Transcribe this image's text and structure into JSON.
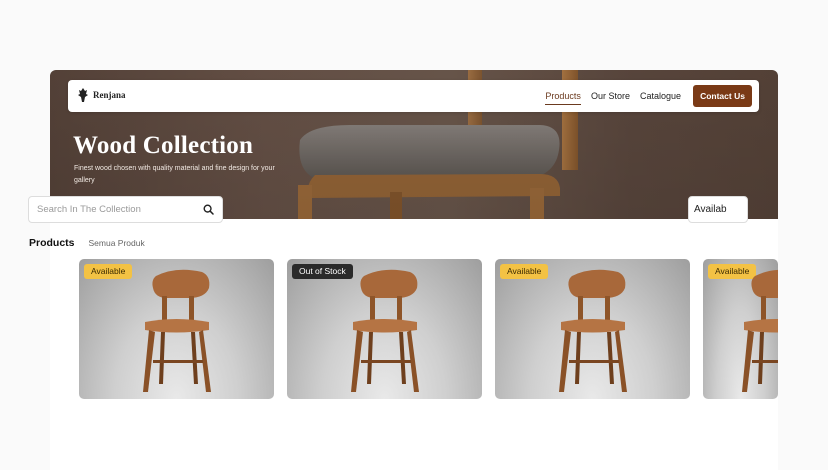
{
  "brand": {
    "name": "Renjana"
  },
  "nav": {
    "items": [
      {
        "label": "Products",
        "active": true
      },
      {
        "label": "Our Store",
        "active": false
      },
      {
        "label": "Catalogue",
        "active": false
      }
    ],
    "contact_label": "Contact Us"
  },
  "hero": {
    "title": "Wood Collection",
    "subtitle": "Finest wood chosen with quality material and fine design for your gallery"
  },
  "search": {
    "placeholder": "Search In The Collection"
  },
  "filter": {
    "selected": "Availab"
  },
  "tabs": {
    "primary": "Products",
    "secondary": "Semua Produk"
  },
  "products": [
    {
      "badge": "Available",
      "status": "available"
    },
    {
      "badge": "Out of Stock",
      "status": "out"
    },
    {
      "badge": "Available",
      "status": "available"
    },
    {
      "badge": "Available",
      "status": "available"
    }
  ],
  "colors": {
    "accent": "#7a3a16",
    "available": "#f3c244",
    "out_of_stock": "#2a2a2a"
  }
}
